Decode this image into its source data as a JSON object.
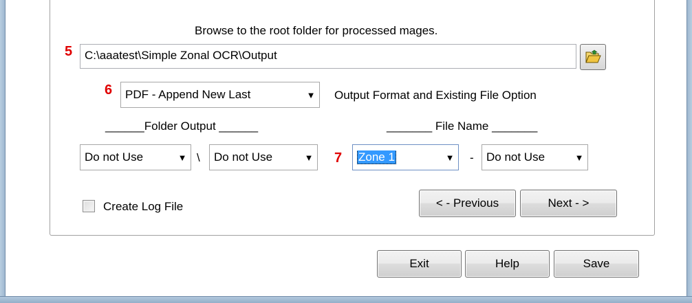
{
  "browse_instruction": "Browse to the root folder for processed mages.",
  "steps": {
    "five": "5",
    "six": "6",
    "seven": "7"
  },
  "root_folder": {
    "value": "C:\\aaatest\\Simple Zonal OCR\\Output"
  },
  "output_format": {
    "selected": "PDF - Append New Last",
    "label": "Output Format and Existing File Option"
  },
  "folder_output": {
    "label": "______Folder Output ______",
    "combo1": "Do not Use",
    "separator": "\\",
    "combo2": "Do not Use"
  },
  "file_name": {
    "label": "_______ File Name _______",
    "combo1": "Zone 1",
    "separator": "-",
    "combo2": "Do not Use"
  },
  "create_log": {
    "label": "Create Log File",
    "checked": false
  },
  "nav": {
    "previous": "< - Previous",
    "next": "Next - >"
  },
  "footer": {
    "exit": "Exit",
    "help": "Help",
    "save": "Save"
  },
  "colors": {
    "step": "#e00000",
    "selection": "#3399ff",
    "frame": "#9fb8d0"
  },
  "icons": {
    "browse": "open-folder-icon",
    "dropdown": "chevron-down-icon"
  }
}
